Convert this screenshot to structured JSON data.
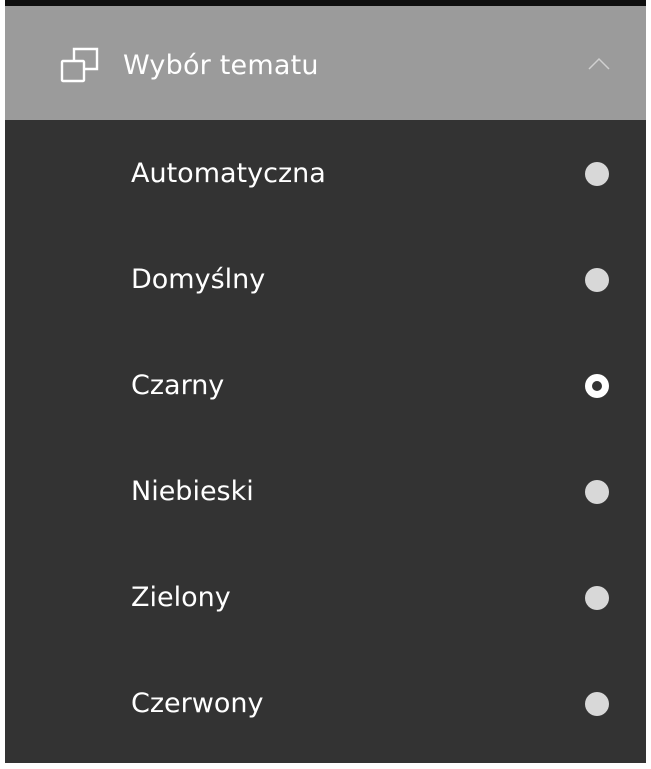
{
  "header": {
    "title": "Wybór tematu",
    "icon": "windows-stack-icon",
    "toggle_icon": "chevron-up-icon",
    "background": "#9b9b9b"
  },
  "theme_options": [
    {
      "label": "Automatyczna",
      "selected": false
    },
    {
      "label": "Domyślny",
      "selected": false
    },
    {
      "label": "Czarny",
      "selected": true
    },
    {
      "label": "Niebieski",
      "selected": false
    },
    {
      "label": "Zielony",
      "selected": false
    },
    {
      "label": "Czerwony",
      "selected": false
    }
  ],
  "colors": {
    "panel_background": "#333333",
    "text": "#ffffff",
    "radio_unselected": "#d8d8d8"
  }
}
